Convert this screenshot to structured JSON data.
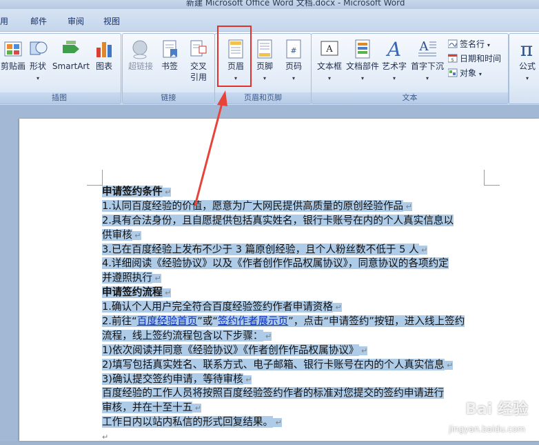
{
  "window": {
    "title": "新建 Microsoft Office Word 文档.docx - Microsoft Word"
  },
  "tabs": [
    "用",
    "邮件",
    "审阅",
    "视图"
  ],
  "ribbon": {
    "groups": {
      "illustrations": {
        "label": "插图",
        "buttons": [
          "剪贴画",
          "形状",
          "SmartArt",
          "图表"
        ]
      },
      "links": {
        "label": "链接",
        "buttons": [
          "超链接",
          "书签",
          "交叉",
          "引用"
        ]
      },
      "header_footer": {
        "label": "页眉和页脚",
        "buttons": [
          "页眉",
          "页脚",
          "页码"
        ]
      },
      "text": {
        "label": "文本",
        "buttons": [
          "文本框",
          "文档部件",
          "艺术字",
          "首字下沉"
        ],
        "small": [
          "签名行",
          "日期和时间",
          "对象"
        ]
      },
      "symbols": {
        "buttons": [
          "公式"
        ]
      }
    }
  },
  "document": {
    "lines": [
      {
        "text": "申请签约条件",
        "bold": true
      },
      {
        "text": "1.认同百度经验的价值，愿意为广大网民提供高质量的原创经验作品"
      },
      {
        "text": "2.具有合法身份，且自愿提供包括真实姓名，银行卡账号在内的个人真实信息以",
        "noMark": true
      },
      {
        "text": "供审核"
      },
      {
        "text": "3.已在百度经验上发布不少于 3 篇原创经验，且个人粉丝数不低于 5 人"
      },
      {
        "text": "4.详细阅读《经验协议》以及《作者创作作品权属协议》，同意协议的各项约定",
        "noMark": true
      },
      {
        "text": "并遵照执行"
      },
      {
        "text": "申请签约流程",
        "bold": true
      },
      {
        "text": "1.确认个人用户完全符合百度经验签约作者申请资格"
      },
      {
        "parts": [
          "2.前往“",
          "百度经验首页",
          "”或“",
          "签约作者展示页",
          "”，点击“申请签约”按钮，进入线上签约"
        ],
        "noMark": true
      },
      {
        "text": "流程，线上签约流程包含以下步骤："
      },
      {
        "text": "1)依次阅读并同意《经验协议》《作者创作作品权属协议》"
      },
      {
        "text": "2)填写包括真实姓名、联系方式、电子邮箱、银行卡账号在内的个人真实信息"
      },
      {
        "text": "3)确认提交签约申请，等待审核"
      },
      {
        "text": "百度经验的工作人员将按照百度经验签约作者的标准对您提交的签约申请进行",
        "noMark": true
      },
      {
        "text": "审核，并在十至十五"
      },
      {
        "text": "工作日内以站内私信的形式回复结果。"
      },
      {
        "text": "",
        "plain": true
      }
    ],
    "paragraph_mark": "↵"
  },
  "watermark": {
    "text": "Bai 经验",
    "url": "jingyan.baidu.com"
  },
  "colors": {
    "selection": "#aecbe8",
    "highlight_box": "#e0312b",
    "link": "#0a2fc0"
  }
}
